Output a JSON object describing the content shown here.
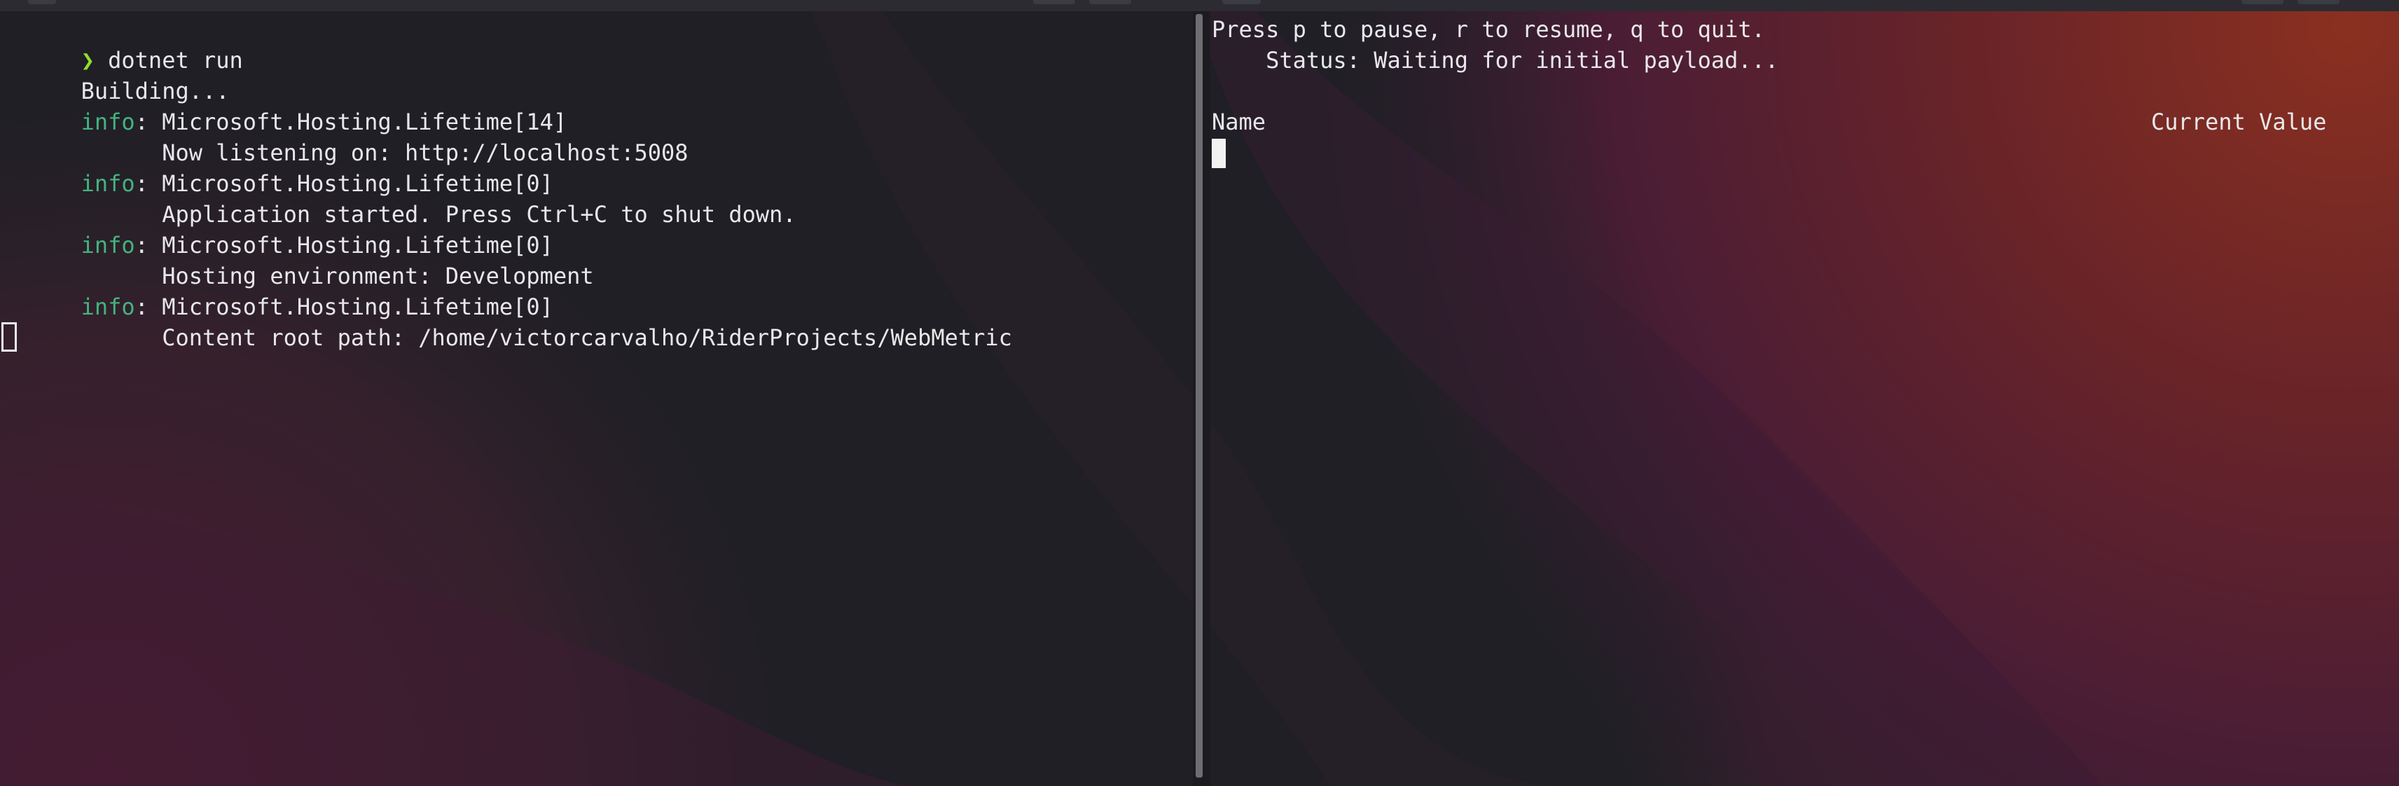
{
  "left_terminal": {
    "command": {
      "prompt_symbol": "❯",
      "text": " dotnet run"
    },
    "lines": [
      {
        "plain": "Building..."
      },
      {
        "level": "info",
        "rest": ": Microsoft.Hosting.Lifetime[14]"
      },
      {
        "plain": "      Now listening on: http://localhost:5008"
      },
      {
        "level": "info",
        "rest": ": Microsoft.Hosting.Lifetime[0]"
      },
      {
        "plain": "      Application started. Press Ctrl+C to shut down."
      },
      {
        "level": "info",
        "rest": ": Microsoft.Hosting.Lifetime[0]"
      },
      {
        "plain": "      Hosting environment: Development"
      },
      {
        "level": "info",
        "rest": ": Microsoft.Hosting.Lifetime[0]"
      },
      {
        "plain": "      Content root path: /home/victorcarvalho/RiderProjects/WebMetric"
      }
    ]
  },
  "right_terminal": {
    "help_line": "Press p to pause, r to resume, q to quit.",
    "status_line": "    Status: Waiting for initial payload...",
    "table": {
      "col_name": "Name",
      "col_value": "Current Value"
    }
  },
  "colors": {
    "prompt_green": "#8fe02a",
    "info_green": "#43b37f",
    "text": "#e8e8ea",
    "bg_dark": "#1f1f25",
    "bg_magenta": "#4a1d38",
    "bg_orange": "#7a2a20"
  }
}
